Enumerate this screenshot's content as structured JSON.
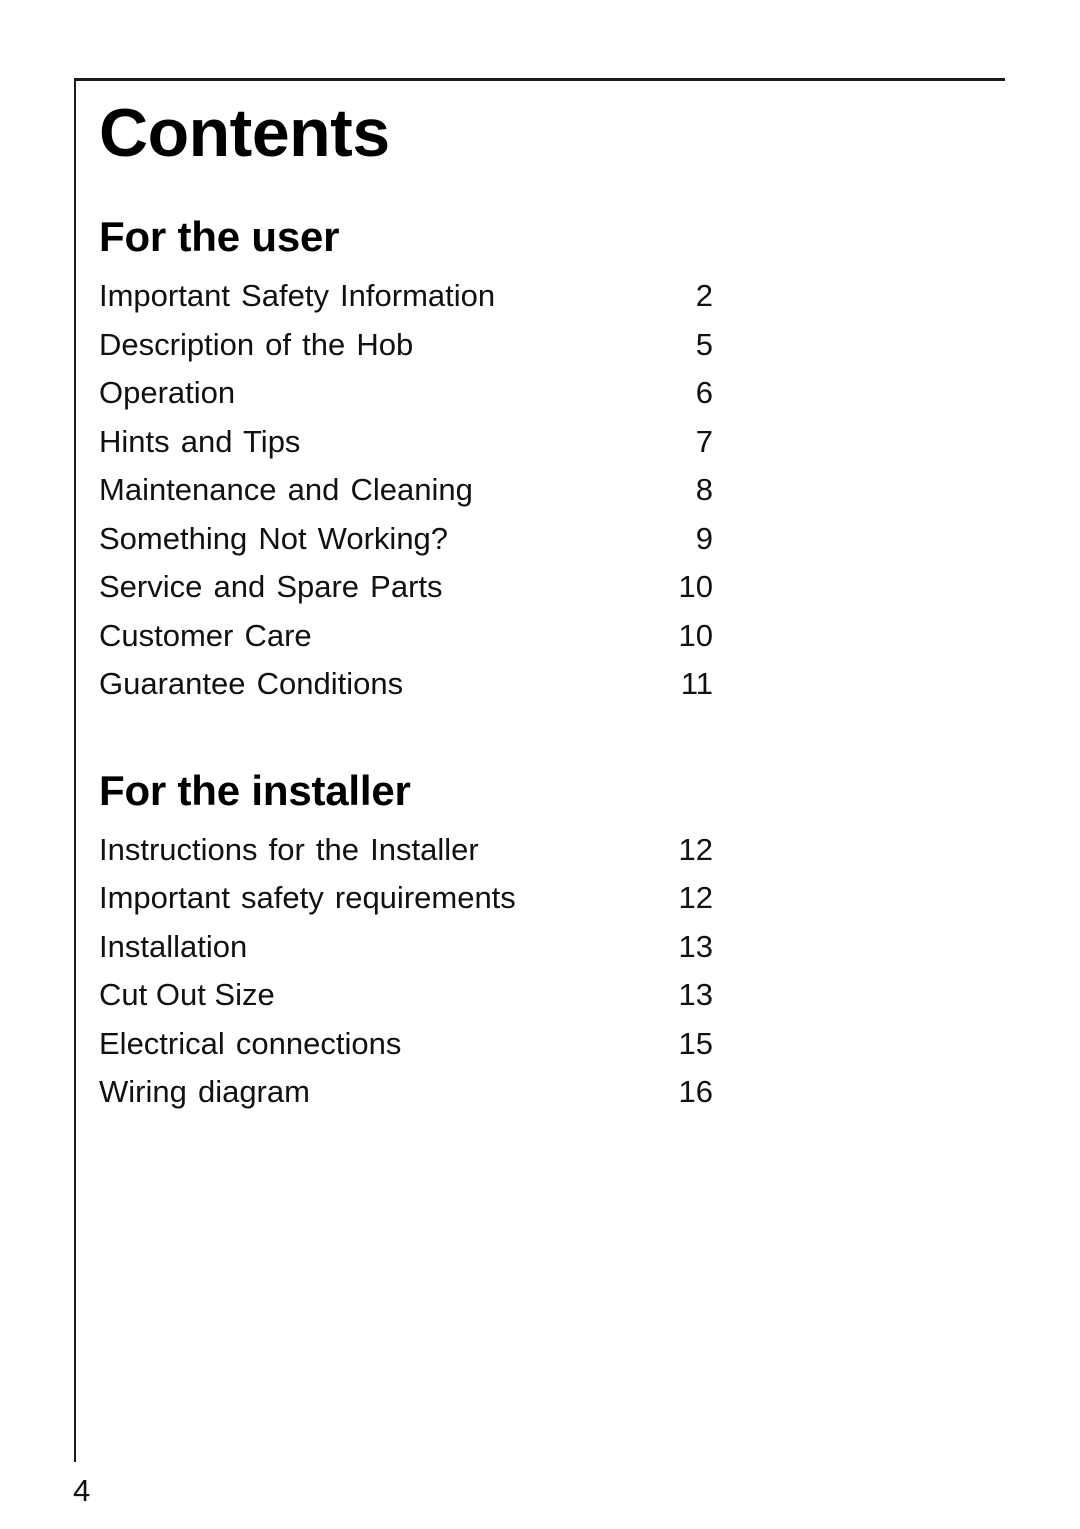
{
  "document": {
    "title": "Contents",
    "page_number": "4"
  },
  "sections": [
    {
      "heading": "For the user",
      "items": [
        {
          "label": "Important Safety Information",
          "page": "2",
          "tight": false
        },
        {
          "label": "Description of the Hob",
          "page": "5",
          "tight": false
        },
        {
          "label": "Operation",
          "page": "6",
          "tight": false
        },
        {
          "label": "Hints and Tips",
          "page": "7",
          "tight": false
        },
        {
          "label": "Maintenance and Cleaning",
          "page": "8",
          "tight": false
        },
        {
          "label": "Something Not Working?",
          "page": "9",
          "tight": false
        },
        {
          "label": "Service and Spare Parts",
          "page": "10",
          "tight": false
        },
        {
          "label": "Customer Care",
          "page": "10",
          "tight": false
        },
        {
          "label": "Guarantee Conditions",
          "page": "11",
          "tight": false
        }
      ]
    },
    {
      "heading": "For the installer",
      "items": [
        {
          "label": "Instructions for the Installer",
          "page": "12",
          "tight": false
        },
        {
          "label": "Important safety requirements",
          "page": "12",
          "tight": false
        },
        {
          "label": "Installation",
          "page": "13",
          "tight": false
        },
        {
          "label": "Cut Out Size",
          "page": "13",
          "tight": true
        },
        {
          "label": "Electrical connections",
          "page": "15",
          "tight": false
        },
        {
          "label": "Wiring diagram",
          "page": "16",
          "tight": false
        }
      ]
    }
  ],
  "colors": {
    "text": "#111111",
    "rule": "#1a1a1a",
    "background": "#ffffff"
  }
}
